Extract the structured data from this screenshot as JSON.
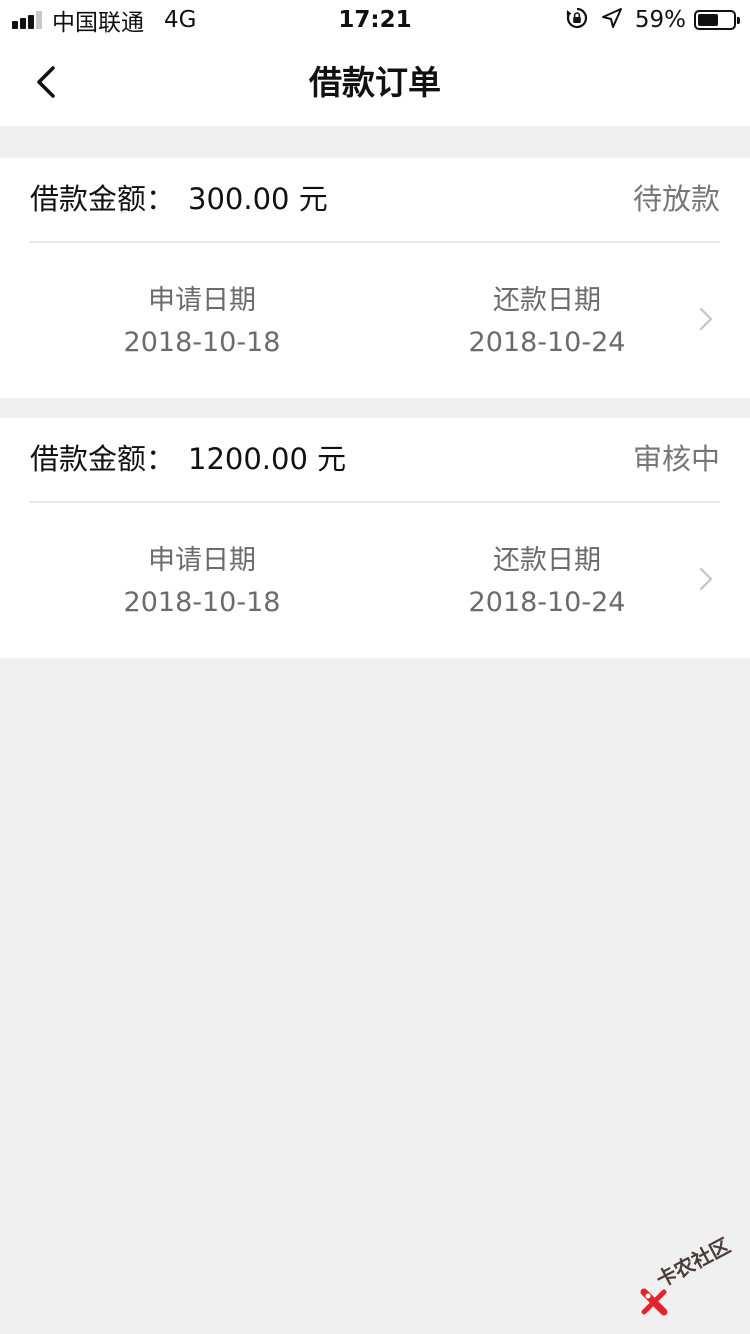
{
  "status_bar": {
    "carrier": "中国联通",
    "network": "4G",
    "time": "17:21",
    "battery_percent": "59%",
    "battery_level": 0.59,
    "signal_bars_filled": 3,
    "signal_bars_total": 4
  },
  "nav": {
    "title": "借款订单",
    "back_icon": "chevron-left-icon"
  },
  "orders": [
    {
      "amount_label": "借款金额：",
      "amount": "300.00 元",
      "status": "待放款",
      "apply_label": "申请日期",
      "apply_date": "2018-10-18",
      "repay_label": "还款日期",
      "repay_date": "2018-10-24"
    },
    {
      "amount_label": "借款金额：",
      "amount": "1200.00 元",
      "status": "审核中",
      "apply_label": "申请日期",
      "apply_date": "2018-10-18",
      "repay_label": "还款日期",
      "repay_date": "2018-10-24"
    }
  ],
  "watermark": {
    "text": "卡农社区"
  },
  "colors": {
    "background": "#f0f0f0",
    "card": "#ffffff",
    "divider": "#e6e6e6",
    "text_primary": "#111111",
    "text_secondary": "#6b6b6b",
    "watermark_accent": "#e2252b"
  }
}
